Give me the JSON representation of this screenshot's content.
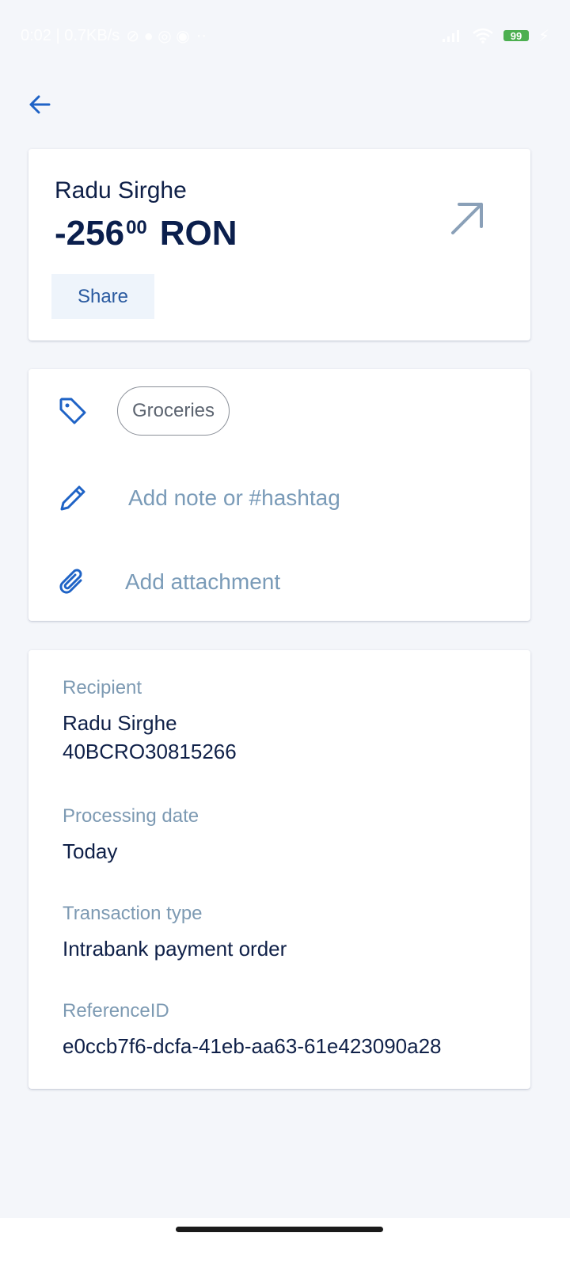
{
  "status_bar": {
    "time_and_speed": "0:02 | 0.7KB/s",
    "battery": "99",
    "more": "··"
  },
  "transaction": {
    "payee": "Radu Sirghe",
    "amount_main": "-256",
    "amount_cents": "00",
    "currency": "RON",
    "share_label": "Share"
  },
  "actions": {
    "category": "Groceries",
    "note_placeholder": "Add note or #hashtag",
    "attachment_label": "Add attachment"
  },
  "details": {
    "recipient_label": "Recipient",
    "recipient_name": "Radu Sirghe",
    "recipient_account": "40BCRO30815266",
    "processing_label": "Processing date",
    "processing_value": "Today",
    "type_label": "Transaction type",
    "type_value": "Intrabank payment order",
    "reference_label": "ReferenceID",
    "reference_value": "e0ccb7f6-dcfa-41eb-aa63-61e423090a28"
  },
  "colors": {
    "accent": "#1f63c6",
    "label": "#7d9ab3",
    "text": "#0f2048"
  }
}
